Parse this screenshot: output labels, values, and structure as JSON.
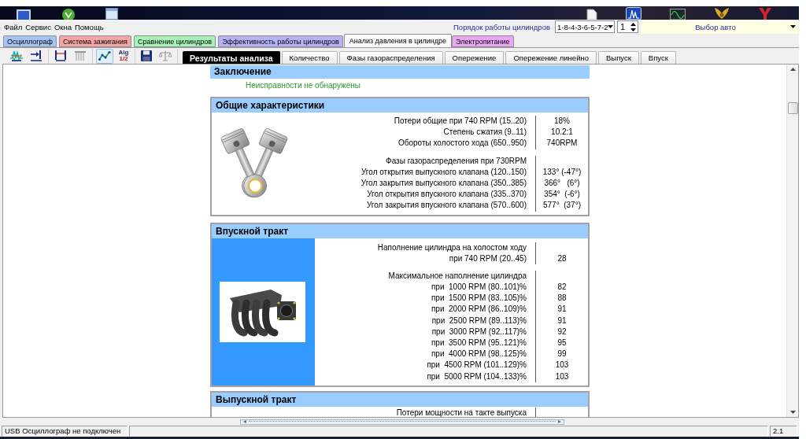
{
  "menu": [
    "Файл",
    "Сервис",
    "Окна",
    "Помощь"
  ],
  "cylinder_order": {
    "label": "Порядок работы цилиндров",
    "value": "1-8-4-3-6-5-7-2",
    "cylinder": "1"
  },
  "car_select": {
    "value": "Выбор авто"
  },
  "tabs": [
    {
      "label": "Осциллограф",
      "color": "#a4c4f4",
      "selected": false
    },
    {
      "label": "Система зажигания",
      "color": "#f4a6a6",
      "selected": false
    },
    {
      "label": "Сравнение цилиндров",
      "color": "#a6f2b8",
      "selected": false
    },
    {
      "label": "Эффективность работы цилиндров",
      "color": "#b6b2f8",
      "selected": false
    },
    {
      "label": "Анализ давления в цилиндре",
      "selected": true
    },
    {
      "label": "Электропитание",
      "color": "#eaa8f4",
      "selected": false
    }
  ],
  "toolbar": [
    [
      {
        "kind": "icon",
        "disabled": false,
        "pressed": false
      },
      {
        "kind": "icon",
        "disabled": false,
        "pressed": false
      }
    ],
    [
      {
        "kind": "icon",
        "disabled": false,
        "pressed": false
      },
      {
        "kind": "icon",
        "disabled": true,
        "pressed": false
      }
    ],
    [
      {
        "kind": "icon",
        "disabled": false,
        "pressed": true
      },
      {
        "kind": "text",
        "label": "Alg",
        "sublabel": "1/2",
        "disabled": false,
        "pressed": false
      }
    ],
    [
      {
        "kind": "icon",
        "disabled": false,
        "pressed": false
      },
      {
        "kind": "icon",
        "disabled": true,
        "pressed": false
      }
    ]
  ],
  "subtabs": [
    {
      "label": "Результаты анализа",
      "selected": true
    },
    {
      "label": "Количество",
      "selected": false
    },
    {
      "label": "Фазы газораспределения",
      "selected": false
    },
    {
      "label": "Опережение",
      "selected": false
    },
    {
      "label": "Опережение линейно",
      "selected": false
    },
    {
      "label": "Выпуск",
      "selected": false
    },
    {
      "label": "Впуск",
      "selected": false
    }
  ],
  "report": {
    "conclusion": {
      "title": "Заключение",
      "text": "Неисправности не обнаружены"
    },
    "sections": [
      {
        "title": "Общие характеристики",
        "kind": "general",
        "groups": [
          {
            "rows": [
              {
                "label": "Потери общие при 740 RPM (15..20)",
                "value": "18%"
              },
              {
                "label": "Степень сжатия (9..11)",
                "value": "10.2:1"
              },
              {
                "label": "Обороты холостого хода (650..950)",
                "value": "740RPM"
              }
            ]
          },
          {
            "rows": [
              {
                "label": "Фазы газораспределения при 730RPM"
              },
              {
                "label": "Угол открытия выпускного клапана (120..150)",
                "value": "133° (-47°)"
              },
              {
                "label": "Угол закрытия выпускного клапана (350..385)",
                "value": "366°   (6°)"
              },
              {
                "label": "Угол открытия впускного клапана (335..370)",
                "value": "354°  (-6°)"
              },
              {
                "label": "Угол закрытия впускного клапана (570..600)",
                "value": "577°  (37°)"
              }
            ]
          }
        ]
      },
      {
        "title": "Впускной тракт",
        "kind": "intake",
        "groups": [
          {
            "rows": [
              {
                "label": "Наполнение цилиндра на холостом ходу"
              },
              {
                "label": "при 740 RPM (20..45)",
                "value": "28"
              }
            ]
          },
          {
            "rows": [
              {
                "label": "Максимальное наполнение цилиндра"
              },
              {
                "label": "при  1000 RPM (80..101)%",
                "value": "82"
              },
              {
                "label": "при  1500 RPM (83..105)%",
                "value": "88"
              },
              {
                "label": "при  2000 RPM (86..109)%",
                "value": "91"
              },
              {
                "label": "при  2500 RPM (89..113)%",
                "value": "91"
              },
              {
                "label": "при  3000 RPM (92..117)%",
                "value": "92"
              },
              {
                "label": "при  3500 RPM (95..121)%",
                "value": "95"
              },
              {
                "label": "при  4000 RPM (98..125)%",
                "value": "99"
              },
              {
                "label": "при  4500 RPM (101..129)%",
                "value": "103"
              },
              {
                "label": "при  5000 RPM (104..133)%",
                "value": "103"
              }
            ]
          }
        ]
      },
      {
        "title": "Выпускной тракт",
        "kind": "exhaust",
        "groups": [
          {
            "rows": [
              {
                "label": "Потери мощности на такте выпуска"
              }
            ]
          }
        ]
      }
    ]
  },
  "status_bar": {
    "message": "USB Осциллограф не подключен",
    "version": "2.1"
  }
}
